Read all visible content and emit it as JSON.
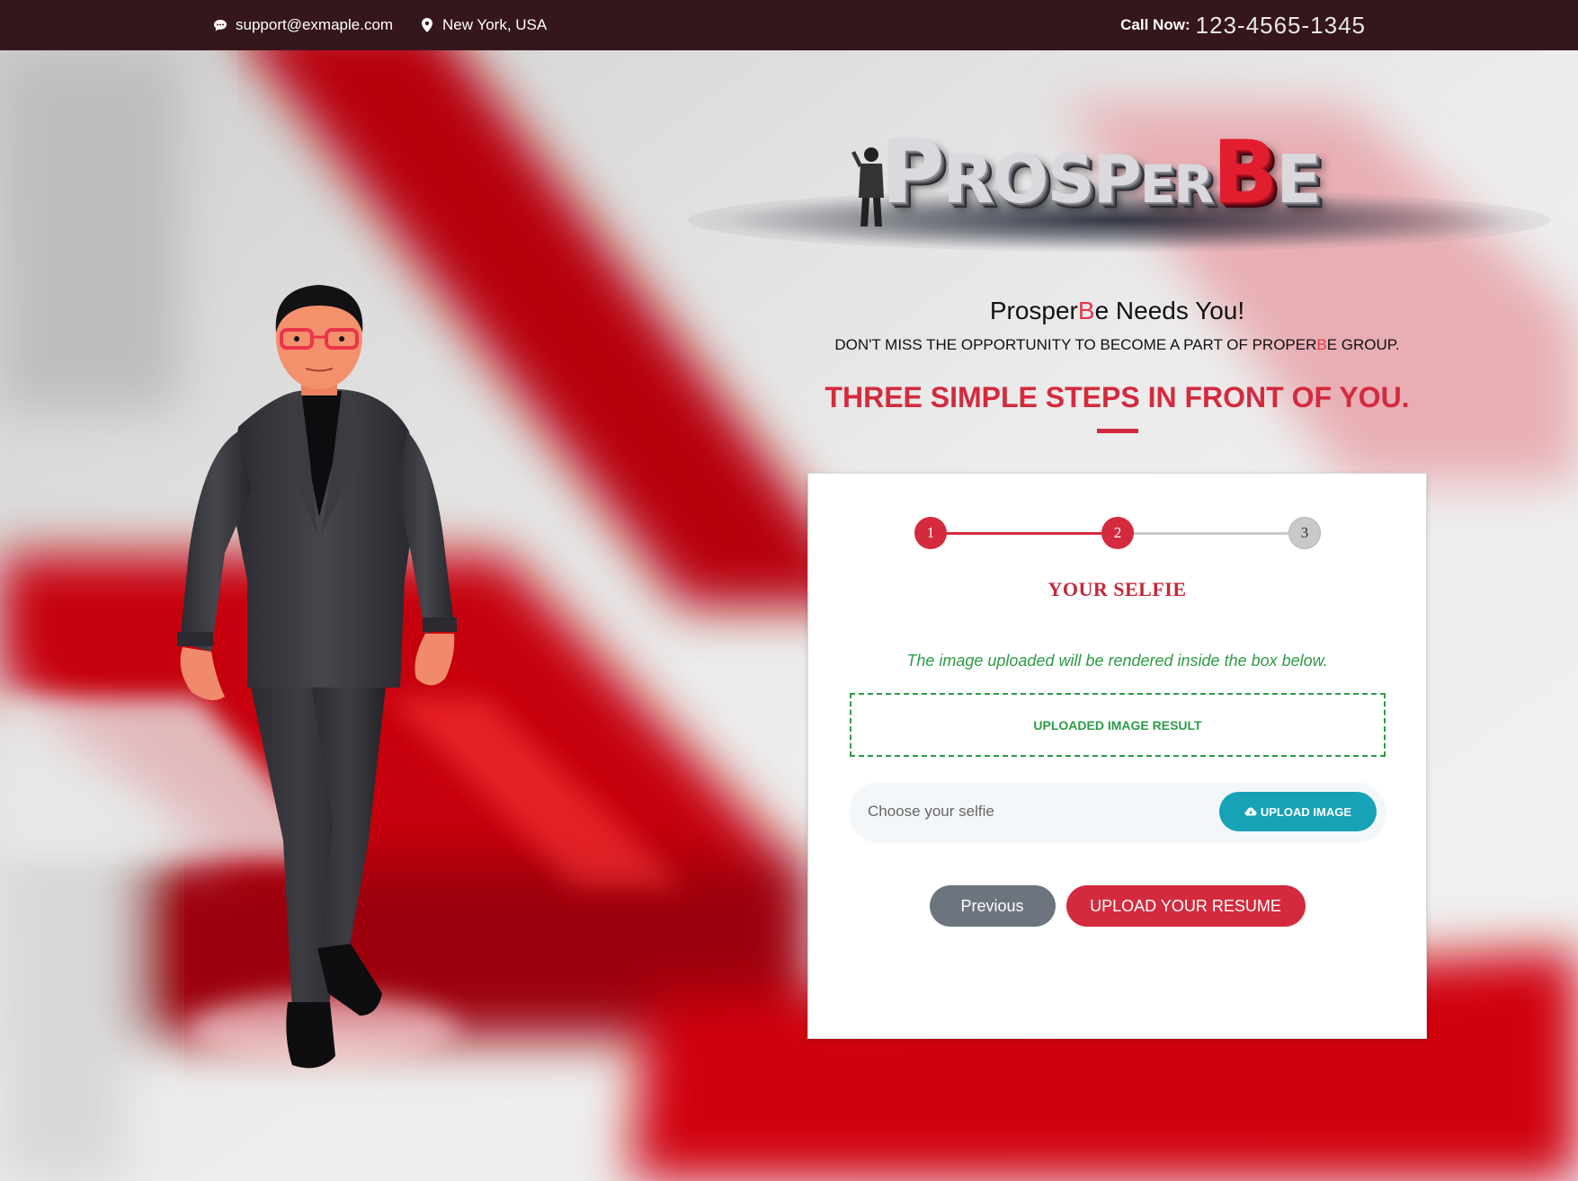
{
  "topbar": {
    "email": "support@exmaple.com",
    "location": "New York, USA",
    "call_label": "Call Now:",
    "call_number": "123-4565-1345",
    "icons": [
      "chat-bubble-icon",
      "map-pin-icon"
    ]
  },
  "logo": {
    "text_parts": [
      "P",
      "ROS",
      "P",
      "ER",
      "B",
      "E"
    ],
    "accent_color": "#e11d2e"
  },
  "headline": {
    "title_before": "Prosper",
    "title_accent": "B",
    "title_after": "e Needs You!",
    "subtitle_before": "DON'T MISS THE OPPORTUNITY TO BECOME A PART OF PROPER",
    "subtitle_accent": "B",
    "subtitle_after": "E GROUP.",
    "steps_title": "THREE SIMPLE STEPS IN FRONT OF YOU."
  },
  "progress": {
    "current_step": 2,
    "total_steps": 3,
    "steps": [
      "1",
      "2",
      "3"
    ]
  },
  "form": {
    "step_heading": "YOUR SELFIE",
    "info_text": "The image uploaded will be rendered inside the box below.",
    "result_box_label": "UPLOADED IMAGE RESULT",
    "file_placeholder": "Choose your selfie",
    "upload_button": "UPLOAD IMAGE",
    "previous_button": "Previous",
    "next_button": "UPLOAD YOUR RESUME"
  },
  "colors": {
    "topbar_bg": "#35161c",
    "accent_red": "#d42a3d",
    "success_green": "#2e9b46",
    "info_teal": "#17a2b8",
    "secondary_gray": "#6c757d"
  }
}
